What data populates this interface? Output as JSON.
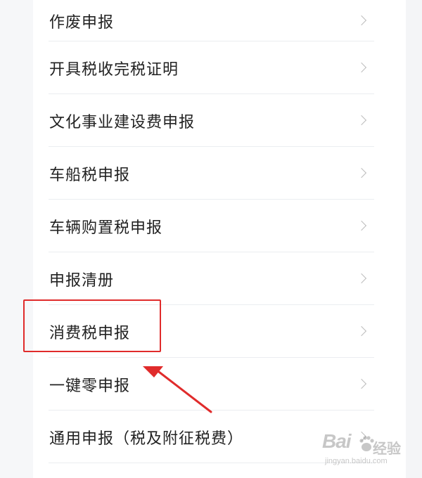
{
  "menu": {
    "items": [
      {
        "label": "作废申报"
      },
      {
        "label": "开具税收完税证明"
      },
      {
        "label": "文化事业建设费申报"
      },
      {
        "label": "车船税申报"
      },
      {
        "label": "车辆购置税申报"
      },
      {
        "label": "申报清册"
      },
      {
        "label": "消费税申报"
      },
      {
        "label": "一键零申报"
      },
      {
        "label": "通用申报（税及附征税费）"
      }
    ]
  },
  "annotation": {
    "highlight_color": "#e02b2b",
    "highlighted_item": "消费税申报"
  },
  "watermark": {
    "logo": "Bai",
    "text": "经验",
    "url": "jingyan.baidu.com"
  }
}
